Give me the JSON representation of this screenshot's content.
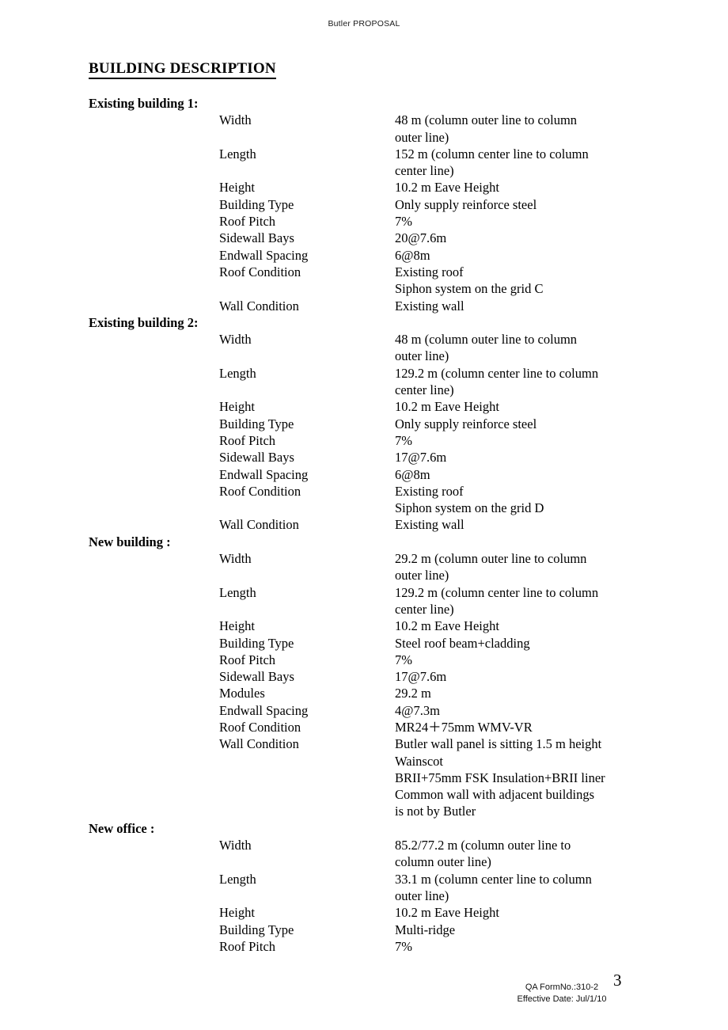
{
  "header": {
    "running_head": "Butler PROPOSAL"
  },
  "title": "BUILDING DESCRIPTION",
  "sections": [
    {
      "heading": "Existing building 1:",
      "rows": [
        {
          "label": "Width",
          "value": "48 m (column outer line to column\nouter line)"
        },
        {
          "label": "Length",
          "value": "152 m (column center line to column\ncenter line)"
        },
        {
          "label": "Height",
          "value": "10.2 m Eave Height"
        },
        {
          "label": "Building Type",
          "value": "Only supply reinforce steel"
        },
        {
          "label": "Roof Pitch",
          "value": "7%"
        },
        {
          "label": "Sidewall Bays",
          "value": "20@7.6m"
        },
        {
          "label": "Endwall Spacing",
          "value": "6@8m"
        },
        {
          "label": "Roof Condition",
          "value": "Existing roof\nSiphon system on the grid C"
        },
        {
          "label": "Wall Condition",
          "value": "Existing wall"
        }
      ]
    },
    {
      "heading": "Existing building 2:",
      "rows": [
        {
          "label": "Width",
          "value": "48 m (column outer line to column\nouter line)"
        },
        {
          "label": "Length",
          "value": "129.2 m (column center line to column\ncenter line)"
        },
        {
          "label": "Height",
          "value": "10.2 m Eave Height"
        },
        {
          "label": "Building Type",
          "value": "Only supply reinforce steel"
        },
        {
          "label": "Roof Pitch",
          "value": "7%"
        },
        {
          "label": "Sidewall Bays",
          "value": "17@7.6m"
        },
        {
          "label": "Endwall Spacing",
          "value": "6@8m"
        },
        {
          "label": "Roof Condition",
          "value": "Existing roof\nSiphon system on the grid D"
        },
        {
          "label": "Wall Condition",
          "value": "Existing wall"
        }
      ]
    },
    {
      "heading": "New building :",
      "rows": [
        {
          "label": "Width",
          "value": "29.2 m (column outer line to column\nouter line)"
        },
        {
          "label": "Length",
          "value": "129.2 m (column center line to column\ncenter line)"
        },
        {
          "label": "Height",
          "value": "10.2 m Eave Height"
        },
        {
          "label": "Building Type",
          "value": "Steel roof beam+cladding"
        },
        {
          "label": "Roof Pitch",
          "value": "7%"
        },
        {
          "label": "Sidewall Bays",
          "value": "17@7.6m"
        },
        {
          "label": "Modules",
          "value": "29.2 m"
        },
        {
          "label": "Endwall Spacing",
          "value": "4@7.3m"
        },
        {
          "label": "Roof Condition",
          "value": "MR24＋75mm WMV-VR"
        },
        {
          "label": "Wall Condition",
          "value": "Butler wall panel is sitting 1.5 m height\nWainscot\nBRII+75mm FSK Insulation+BRII liner\nCommon wall with adjacent buildings\nis not by Butler"
        }
      ]
    },
    {
      "heading": "New office :",
      "rows": [
        {
          "label": "Width",
          "value": "85.2/77.2 m (column outer line to\ncolumn outer line)"
        },
        {
          "label": "Length",
          "value": "33.1 m (column center line to column\nouter line)"
        },
        {
          "label": "Height",
          "value": "10.2 m Eave Height"
        },
        {
          "label": "Building Type",
          "value": "Multi-ridge"
        },
        {
          "label": "Roof Pitch",
          "value": "7%"
        }
      ]
    }
  ],
  "footer": {
    "form_no": "QA FormNo.:310-2",
    "effective_date": "Effective Date: Jul/1/10",
    "page_number": "3"
  }
}
